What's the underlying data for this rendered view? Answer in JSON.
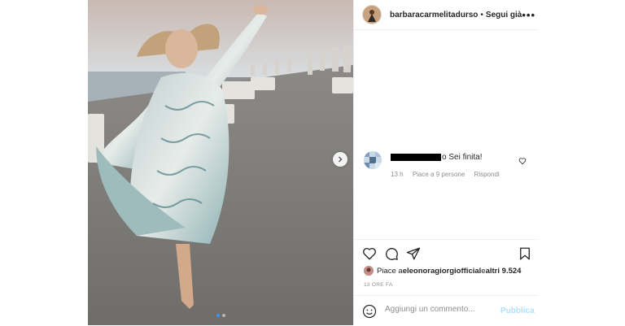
{
  "post": {
    "photo_alt": "Donna con abito lungo sulla spiaggia",
    "carousel": {
      "count": 2,
      "active_index": 0
    }
  },
  "header": {
    "username": "barbaracarmelitadurso",
    "separator": "•",
    "follow_label": "Segui già",
    "more_label": "•••"
  },
  "comment": {
    "text": "o Sei finita!",
    "age": "13 h",
    "likes": "Piace a 9 persone",
    "reply_label": "Rispondi"
  },
  "likes_line": {
    "prefix": "Piace a ",
    "user": "eleonoragiorgiofficial",
    "middle": " e ",
    "others": "altri 9.524"
  },
  "timestamp": "13 ORE FA",
  "add_comment": {
    "placeholder": "Aggiungi un commento...",
    "publish_label": "Pubblica"
  },
  "colors": {
    "accent": "#3897f0",
    "publish_disabled": "#b2dffc",
    "border": "#efefef",
    "muted": "#8e8e8e"
  }
}
